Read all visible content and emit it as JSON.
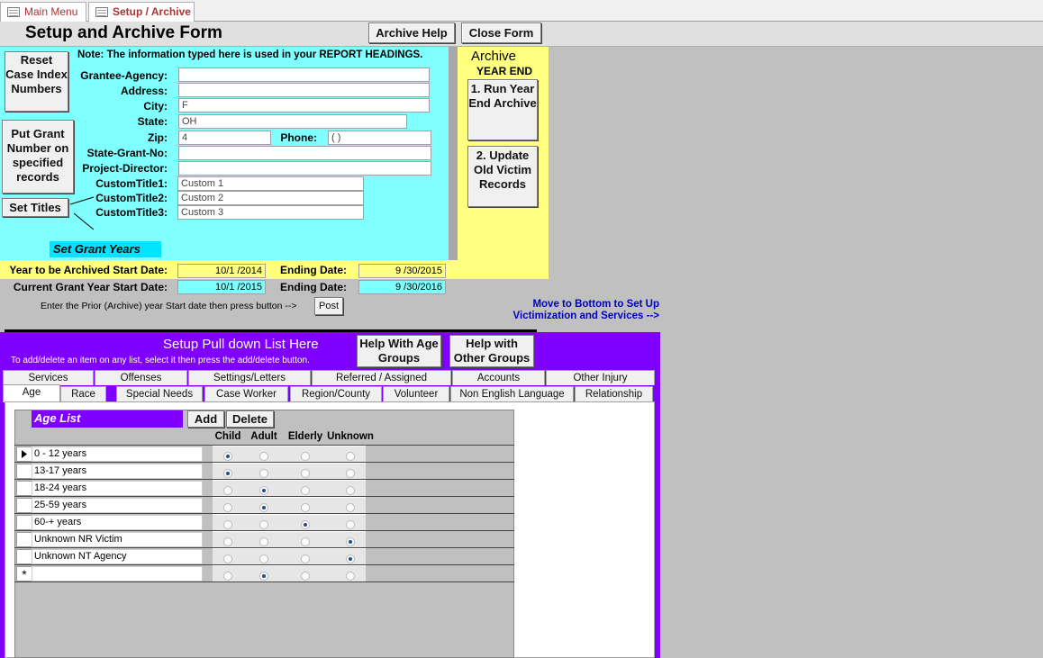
{
  "tabs": {
    "main_menu": "Main Menu",
    "setup_archive": "Setup / Archive"
  },
  "header": {
    "title": "Setup and Archive Form",
    "archive_help": "Archive Help",
    "close_form": "Close Form"
  },
  "left_buttons": {
    "reset": "Reset Case Index Numbers",
    "put_grant": "Put Grant Number on specified records",
    "set_titles": "Set Titles"
  },
  "note": "Note: The information typed here is used in your REPORT HEADINGS.",
  "fields": [
    {
      "label": "Grantee-Agency:",
      "value": ""
    },
    {
      "label": "Address:",
      "value": ""
    },
    {
      "label": "City:",
      "value": "F"
    },
    {
      "label": "State:",
      "value": "OH"
    },
    {
      "label": "Zip:",
      "value": "4"
    },
    {
      "label": "Phone:",
      "value": "(  )"
    },
    {
      "label": "State-Grant-No:",
      "value": ""
    },
    {
      "label": "Project-Director:",
      "value": ""
    },
    {
      "label": "CustomTitle1:",
      "value": "Custom 1"
    },
    {
      "label": "CustomTitle2:",
      "value": "Custom 2"
    },
    {
      "label": "CustomTitle3:",
      "value": "Custom 3"
    }
  ],
  "set_grant_years": "Set Grant Years",
  "archive": {
    "title": "Archive",
    "year_end": "YEAR END",
    "run": "1. Run Year End Archive",
    "update": "2. Update Old Victim Records"
  },
  "dates": {
    "archive_start_label": "Year to be Archived Start Date:",
    "archive_start": "10/1 /2014",
    "ending_label": "Ending Date:",
    "archive_end": "9 /30/2015",
    "current_start_label": "Current Grant Year Start Date:",
    "current_start": "10/1 /2015",
    "current_end": "9 /30/2016",
    "instruction": "Enter the Prior (Archive) year Start date then press button -->",
    "post": "Post"
  },
  "move_bottom": "Move to Bottom to Set Up Victimization and Services -->",
  "pulldown": {
    "title": "Setup Pull down List Here",
    "subtitle": "To add/delete an item on any list, select it then press the add/delete button.",
    "help_age": "Help With Age Groups",
    "help_other": "Help with Other Groups",
    "tabs_row1": [
      "Services",
      "Offenses",
      "Settings/Letters",
      "Referred / Assigned",
      "Accounts",
      "Other Injury"
    ],
    "tabs_row2": [
      "Age",
      "Race",
      "Special Needs",
      "Case Worker",
      "Region/County",
      "Volunteer",
      "Non English Language",
      "Relationship"
    ]
  },
  "age_list": {
    "title": "Age List",
    "add": "Add",
    "delete": "Delete",
    "columns": [
      "Child",
      "Adult",
      "Elderly",
      "Unknown"
    ],
    "rows": [
      {
        "name": "0 - 12 years",
        "sel": 0
      },
      {
        "name": "13-17 years",
        "sel": 0
      },
      {
        "name": "18-24 years",
        "sel": 1
      },
      {
        "name": "25-59 years",
        "sel": 1
      },
      {
        "name": "60-+ years",
        "sel": 2
      },
      {
        "name": "Unknown NR Victim",
        "sel": 3
      },
      {
        "name": "Unknown NT Agency",
        "sel": 3
      },
      {
        "name": "",
        "sel": 1
      }
    ]
  }
}
